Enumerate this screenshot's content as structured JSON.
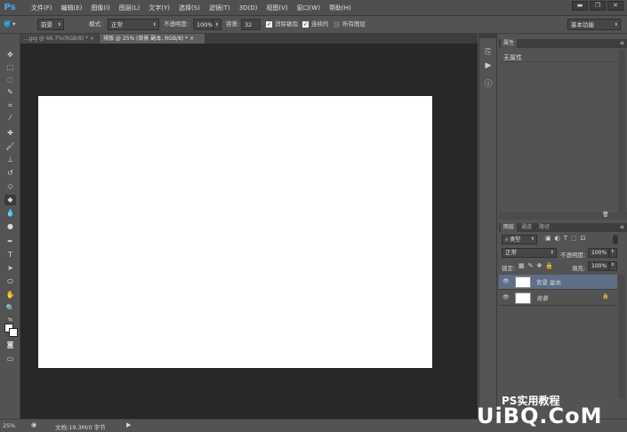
{
  "menu": {
    "logo": "Ps",
    "items": [
      "文件(F)",
      "编辑(E)",
      "图像(I)",
      "图层(L)",
      "文字(Y)",
      "选择(S)",
      "滤镜(T)",
      "3D(D)",
      "视图(V)",
      "窗口(W)",
      "帮助(H)"
    ],
    "window_controls": [
      "▬",
      "❐",
      "✕"
    ]
  },
  "options": {
    "brush_size": "40",
    "preset": "前景",
    "mode_label": "模式:",
    "mode_value": "正常",
    "opacity_label": "不透明度:",
    "opacity_value": "100%",
    "tolerance_label": "容差:",
    "tolerance_value": "32",
    "antialias": "消除锯齿",
    "contiguous": "连续的",
    "all_layers": "所有图层",
    "workspace": "基本功能"
  },
  "tabs": [
    {
      "label": "...jpg @ 66.7%(RGB/8) *",
      "close": "×"
    },
    {
      "label": "排版 @ 25% (背景 副本, RGB/8) *",
      "close": "×"
    }
  ],
  "properties_panel": {
    "tab": "属性",
    "content": "无属性"
  },
  "layers_panel": {
    "tabs": [
      "图层",
      "通道",
      "路径"
    ],
    "filter_label": "类型",
    "blend_mode": "正常",
    "opacity_label": "不透明度:",
    "opacity_value": "100%",
    "lock_label": "锁定:",
    "fill_label": "填充:",
    "fill_value": "100%",
    "layers": [
      {
        "name": "背景 副本",
        "selected": true
      },
      {
        "name": "背景",
        "selected": false,
        "locked": true
      }
    ]
  },
  "status": {
    "zoom": "25%",
    "doc_info": "文档:19.3M/0 字节"
  },
  "watermark": {
    "line1": "PS实用教程",
    "line2": "UiBQ.CoM"
  }
}
